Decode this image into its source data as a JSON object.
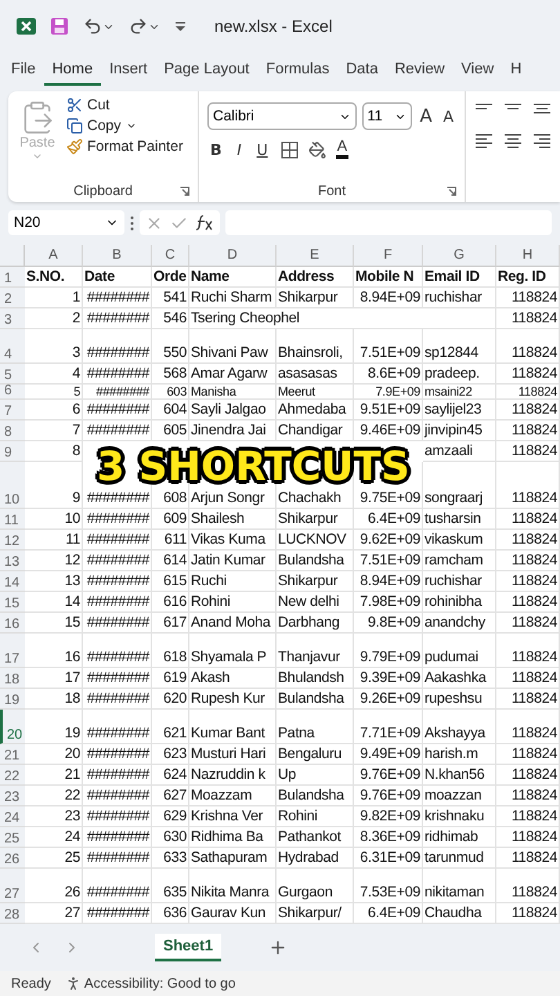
{
  "window": {
    "title": "new.xlsx  -  Excel"
  },
  "ribbon_tabs": [
    {
      "label": "File",
      "selected": false
    },
    {
      "label": "Home",
      "selected": true
    },
    {
      "label": "Insert",
      "selected": false
    },
    {
      "label": "Page Layout",
      "selected": false
    },
    {
      "label": "Formulas",
      "selected": false
    },
    {
      "label": "Data",
      "selected": false
    },
    {
      "label": "Review",
      "selected": false
    },
    {
      "label": "View",
      "selected": false
    },
    {
      "label": "H",
      "selected": false
    }
  ],
  "clipboard": {
    "label": "Clipboard",
    "paste": {
      "label": "Paste",
      "disabled": true
    },
    "items": [
      "Cut",
      "Copy",
      "Format Painter"
    ]
  },
  "font": {
    "label": "Font",
    "font_name": "Calibri",
    "font_size": "11",
    "size_buttons": [
      "A",
      "A"
    ],
    "format_buttons": [
      "B",
      "I",
      "U"
    ],
    "font_color_button": "A"
  },
  "formula_bar": {
    "name_box": "N20"
  },
  "columns": [
    "A",
    "B",
    "C",
    "D",
    "E",
    "F",
    "G",
    "H"
  ],
  "rows": [
    {
      "number": "1",
      "kind": "header",
      "active": false,
      "cells": [
        "S.NO.",
        "Date",
        "Orde",
        "Name",
        "Address",
        "Mobile N",
        "Email ID",
        "Reg. ID"
      ]
    },
    {
      "number": "2",
      "kind": "normal",
      "active": false,
      "cells": [
        "1",
        "########",
        "541",
        "Ruchi Sharm",
        "Shikarpur",
        "8.94E+09",
        "ruchishar",
        "118824"
      ]
    },
    {
      "number": "3",
      "kind": "normal",
      "active": false,
      "cells": [
        "2",
        "########",
        "546",
        "Tsering Cheophel",
        null,
        null,
        null,
        "118824"
      ]
    },
    {
      "number": "4",
      "kind": "tall",
      "active": false,
      "cells": [
        "3",
        "########",
        "550",
        "Shivani Paw",
        "Bhainsroli,",
        "7.51E+09",
        "sp12844",
        "118824"
      ]
    },
    {
      "number": "5",
      "kind": "normal",
      "active": false,
      "cells": [
        "4",
        "########",
        "568",
        "Amar Agarw",
        "asasasas",
        "8.6E+09",
        "pradeep.",
        "118824"
      ]
    },
    {
      "number": "6",
      "kind": "short",
      "active": false,
      "cells": [
        "5",
        "########",
        "603",
        "Manisha",
        "Meerut",
        "7.9E+09",
        "msaini22",
        "118824"
      ]
    },
    {
      "number": "7",
      "kind": "normal",
      "active": false,
      "cells": [
        "6",
        "########",
        "604",
        "Sayli Jalgao",
        "Ahmedaba",
        "9.51E+09",
        "saylijel23",
        "118824"
      ]
    },
    {
      "number": "8",
      "kind": "normal",
      "active": false,
      "cells": [
        "7",
        "########",
        "605",
        "Jinendra Jai",
        "Chandigar",
        "9.46E+09",
        "jinvipin45",
        "118824"
      ]
    },
    {
      "number": "9",
      "kind": "normal",
      "active": false,
      "cells": [
        "8",
        null,
        null,
        null,
        null,
        null,
        "amzaali",
        "118824"
      ]
    },
    {
      "number": "10",
      "kind": "extra-tall",
      "active": false,
      "cells": [
        "9",
        "########",
        "608",
        "Arjun Songr",
        "Chachakh",
        "9.75E+09",
        "songraarj",
        "118824"
      ]
    },
    {
      "number": "11",
      "kind": "normal",
      "active": false,
      "cells": [
        "10",
        "########",
        "609",
        "Shailesh",
        "Shikarpur",
        "6.4E+09",
        "tusharsin",
        "118824"
      ]
    },
    {
      "number": "12",
      "kind": "normal",
      "active": false,
      "cells": [
        "11",
        "########",
        "611",
        "Vikas Kuma",
        "LUCKNOV",
        "9.62E+09",
        "vikaskum",
        "118824"
      ]
    },
    {
      "number": "13",
      "kind": "normal",
      "active": false,
      "cells": [
        "12",
        "########",
        "614",
        "Jatin Kumar",
        "Bulandsha",
        "7.51E+09",
        "ramcham",
        "118824"
      ]
    },
    {
      "number": "14",
      "kind": "normal",
      "active": false,
      "cells": [
        "13",
        "########",
        "615",
        "Ruchi",
        "Shikarpur",
        "8.94E+09",
        "ruchishar",
        "118824"
      ]
    },
    {
      "number": "15",
      "kind": "normal",
      "active": false,
      "cells": [
        "14",
        "########",
        "616",
        "Rohini",
        "New delhi",
        "7.98E+09",
        "rohinibha",
        "118824"
      ]
    },
    {
      "number": "16",
      "kind": "normal",
      "active": false,
      "cells": [
        "15",
        "########",
        "617",
        "Anand Moha",
        "Darbhang",
        "9.8E+09",
        "anandchy",
        "118824"
      ]
    },
    {
      "number": "17",
      "kind": "tall",
      "active": false,
      "cells": [
        "16",
        "########",
        "618",
        "Shyamala P",
        "Thanjavur",
        "9.79E+09",
        "pudumai",
        "118824"
      ]
    },
    {
      "number": "18",
      "kind": "normal",
      "active": false,
      "cells": [
        "17",
        "########",
        "619",
        "Akash",
        "Bhulandsh",
        "9.39E+09",
        "Aakashka",
        "118824"
      ]
    },
    {
      "number": "19",
      "kind": "normal",
      "active": false,
      "cells": [
        "18",
        "########",
        "620",
        "Rupesh Kur",
        "Bulandsha",
        "9.26E+09",
        "rupeshsu",
        "118824"
      ]
    },
    {
      "number": "20",
      "kind": "tall",
      "active": true,
      "cells": [
        "19",
        "########",
        "621",
        "Kumar Bant",
        "Patna",
        "7.71E+09",
        "Akshayya",
        "118824"
      ]
    },
    {
      "number": "21",
      "kind": "normal",
      "active": false,
      "cells": [
        "20",
        "########",
        "623",
        "Musturi Hari",
        "Bengaluru",
        "9.49E+09",
        "harish.m",
        "118824"
      ]
    },
    {
      "number": "22",
      "kind": "normal",
      "active": false,
      "cells": [
        "21",
        "########",
        "624",
        "Nazruddin k",
        "Up",
        "9.76E+09",
        "N.khan56",
        "118824"
      ]
    },
    {
      "number": "23",
      "kind": "normal",
      "active": false,
      "cells": [
        "22",
        "########",
        "627",
        "Moazzam",
        "Bulandsha",
        "9.76E+09",
        "moazzan",
        "118824"
      ]
    },
    {
      "number": "24",
      "kind": "normal",
      "active": false,
      "cells": [
        "23",
        "########",
        "629",
        "Krishna Ver",
        "Rohini",
        "9.82E+09",
        "krishnaku",
        "118824"
      ]
    },
    {
      "number": "25",
      "kind": "normal",
      "active": false,
      "cells": [
        "24",
        "########",
        "630",
        "Ridhima Ba",
        "Pathankot",
        "8.36E+09",
        "ridhimab",
        "118824"
      ]
    },
    {
      "number": "26",
      "kind": "normal",
      "active": false,
      "cells": [
        "25",
        "########",
        "633",
        "Sathapuram",
        "Hydrabad",
        "6.31E+09",
        "tarunmud",
        "118824"
      ]
    },
    {
      "number": "27",
      "kind": "tall",
      "active": false,
      "cells": [
        "26",
        "########",
        "635",
        "Nikita Manra",
        "Gurgaon",
        "7.53E+09",
        "nikitaman",
        "118824"
      ]
    },
    {
      "number": "28",
      "kind": "normal",
      "active": false,
      "cells": [
        "27",
        "########",
        "636",
        "Gaurav Kun",
        "Shikarpur/",
        "6.4E+09",
        "Chaudha",
        "118824"
      ]
    }
  ],
  "overlay_caption": "3 SHORTCUTS",
  "sheet_tabs": [
    {
      "label": "Sheet1",
      "selected": true
    }
  ],
  "status_bar": {
    "status": "Ready",
    "accessibility": "Accessibility: Good to go"
  }
}
